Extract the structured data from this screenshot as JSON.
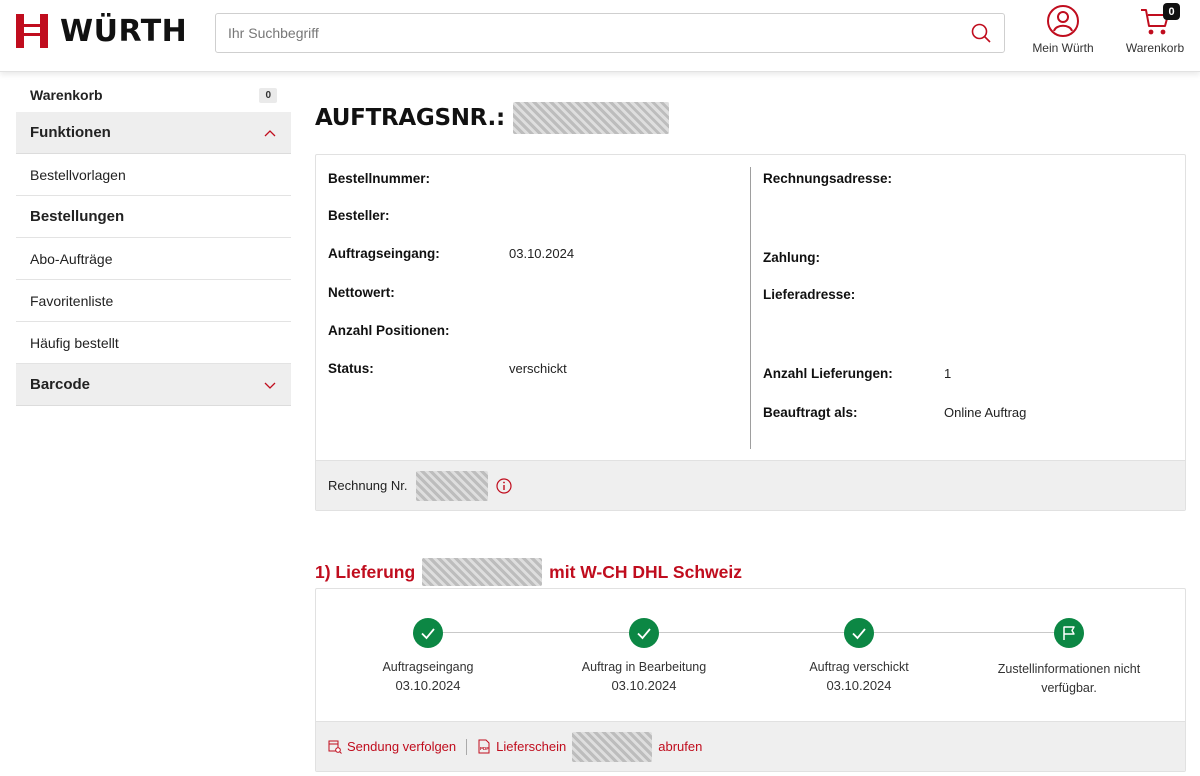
{
  "header": {
    "logo_text": "WÜRTH",
    "search_placeholder": "Ihr Suchbegriff",
    "account_label": "Mein Würth",
    "cart_label": "Warenkorb",
    "cart_count": "0",
    "brand_color": "#c00d1e"
  },
  "sidebar": {
    "cart_label": "Warenkorb",
    "cart_count": "0",
    "functions_label": "Funktionen",
    "items": [
      "Bestellvorlagen",
      "Bestellungen",
      "Abo-Aufträge",
      "Favoritenliste",
      "Häufig bestellt"
    ],
    "active_item": "Bestellungen",
    "barcode_label": "Barcode"
  },
  "order": {
    "title": "AUFTRAGSNR.:",
    "left_fields": {
      "bestellnummer": "Bestellnummer:",
      "besteller": "Besteller:",
      "auftragseingang": "Auftragseingang:",
      "auftragseingang_value": "03.10.2024",
      "nettowert": "Nettowert:",
      "anzahl_positionen": "Anzahl Positionen:",
      "status": "Status:",
      "status_value": "verschickt"
    },
    "right_fields": {
      "rechnungsadresse": "Rechnungsadresse:",
      "zahlung": "Zahlung:",
      "lieferadresse": "Lieferadresse:",
      "anzahl_lieferungen": "Anzahl Lieferungen:",
      "anzahl_lieferungen_value": "1",
      "beauftragt_als": "Beauftragt als:",
      "beauftragt_als_value": "Online Auftrag"
    },
    "invoice_label": "Rechnung Nr."
  },
  "delivery": {
    "title_prefix": "1) Lieferung",
    "title_suffix": "mit W-CH DHL Schweiz",
    "steps": [
      {
        "label": "Auftragseingang",
        "date": "03.10.2024",
        "icon": "check-icon"
      },
      {
        "label": "Auftrag in Bearbeitung",
        "date": "03.10.2024",
        "icon": "check-icon"
      },
      {
        "label": "Auftrag verschickt",
        "date": "03.10.2024",
        "icon": "check-icon"
      },
      {
        "label": "Zustellinformationen nicht verfügbar.",
        "date": "",
        "icon": "flag-icon"
      }
    ],
    "track_link": "Sendung verfolgen",
    "delivery_note_prefix": "Lieferschein",
    "delivery_note_suffix": "abrufen",
    "status_color": "#0c8744"
  }
}
